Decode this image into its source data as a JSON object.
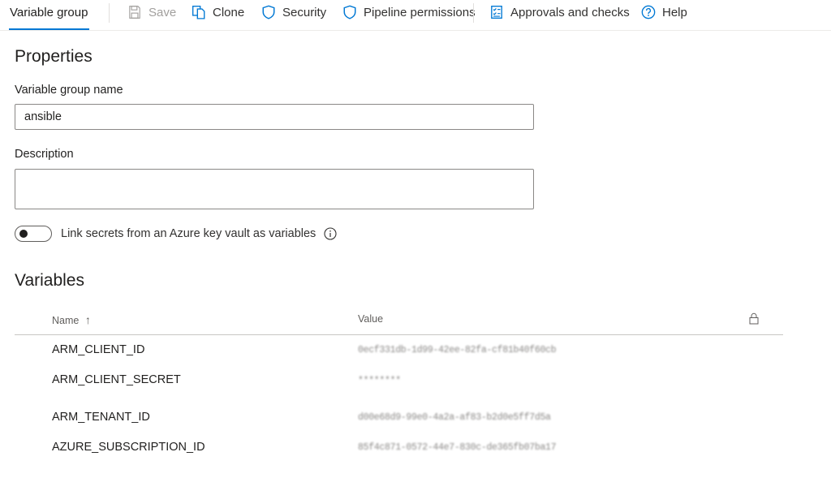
{
  "toolbar": {
    "tab_label": "Variable group",
    "save_label": "Save",
    "clone_label": "Clone",
    "security_label": "Security",
    "pipeline_permissions_label": "Pipeline permissions",
    "approvals_label": "Approvals and checks",
    "help_label": "Help"
  },
  "properties": {
    "heading": "Properties",
    "name_label": "Variable group name",
    "name_value": "ansible",
    "description_label": "Description",
    "description_value": "",
    "link_secrets_label": "Link secrets from an Azure key vault as variables",
    "link_secrets_on": false
  },
  "variables": {
    "heading": "Variables",
    "columns": {
      "name": "Name",
      "sort_arrow": "↑",
      "value": "Value"
    },
    "rows": [
      {
        "name": "ARM_CLIENT_ID",
        "value": "0ecf331db-1d99-42ee-82fa-cf81b40f60cb"
      },
      {
        "name": "ARM_CLIENT_SECRET",
        "value": "********"
      },
      {
        "name": "ARM_TENANT_ID",
        "value": "d00e68d9-99e0-4a2a-af83-b2d0e5ff7d5a"
      },
      {
        "name": "AZURE_SUBSCRIPTION_ID",
        "value": "85f4c871-0572-44e7-830c-de365fb07ba17"
      }
    ]
  },
  "colors": {
    "accent": "#0078d4",
    "text": "#201f1e",
    "muted": "#605e5c",
    "border": "#8a8886"
  },
  "icons": [
    "save-icon",
    "clone-icon",
    "shield-icon",
    "checklist-icon",
    "help-icon",
    "info-icon",
    "lock-icon"
  ]
}
